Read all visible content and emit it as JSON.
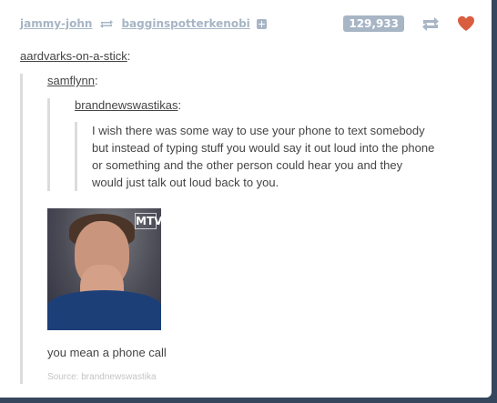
{
  "header": {
    "poster": "jammy-john",
    "reblogged_from": "bagginspotterkenobi",
    "notes_count": "129,933"
  },
  "thread": {
    "user1": "aardvarks-on-a-stick",
    "user2": "samflynn",
    "user3": "brandnewswastikas",
    "quote_lines": [
      "I wish there was some way to use your phone to text somebody",
      "but instead of typing stuff you would say it out loud into the phone",
      "or something and the other person could hear you and they",
      "would just talk out loud back to you."
    ],
    "gif_logo": "MTV",
    "reply": "you mean a phone call"
  },
  "source": {
    "label": "Source:",
    "name": "brandnewswastika"
  },
  "icons": {
    "reblog_small": "reblog-icon",
    "follow": "plus-square-icon",
    "reblog": "reblog-icon",
    "like": "heart-icon"
  },
  "colors": {
    "dashboard_bg": "#36465d",
    "muted": "#a7b5c5",
    "heart": "#d95e40"
  }
}
